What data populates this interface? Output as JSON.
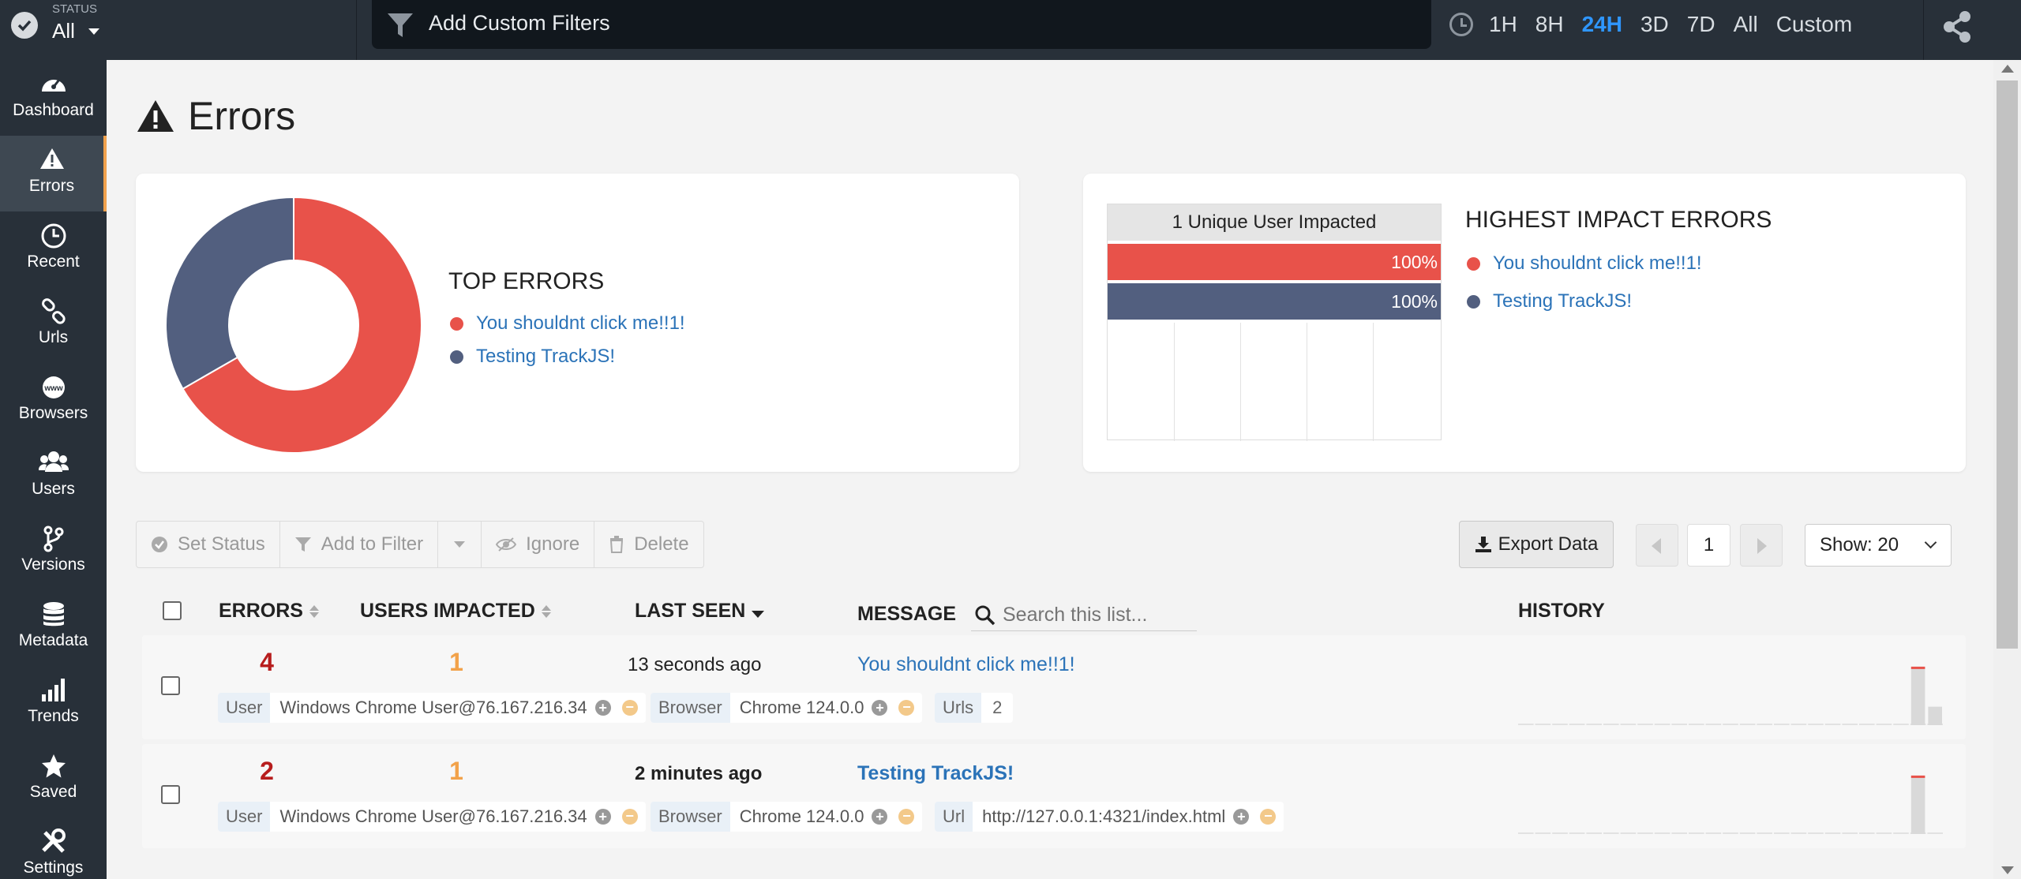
{
  "status": {
    "label": "STATUS",
    "value": "All"
  },
  "filter": {
    "placeholder": "Add Custom Filters"
  },
  "time_ranges": [
    {
      "label": "1H",
      "active": false
    },
    {
      "label": "8H",
      "active": false
    },
    {
      "label": "24H",
      "active": true
    },
    {
      "label": "3D",
      "active": false
    },
    {
      "label": "7D",
      "active": false
    },
    {
      "label": "All",
      "active": false
    },
    {
      "label": "Custom",
      "active": false
    }
  ],
  "sidebar": {
    "items": [
      {
        "label": "Dashboard",
        "icon": "dashboard-icon"
      },
      {
        "label": "Errors",
        "icon": "warning-icon",
        "active": true
      },
      {
        "label": "Recent",
        "icon": "clock-icon"
      },
      {
        "label": "Urls",
        "icon": "link-icon"
      },
      {
        "label": "Browsers",
        "icon": "globe-icon"
      },
      {
        "label": "Users",
        "icon": "users-icon"
      },
      {
        "label": "Versions",
        "icon": "branch-icon"
      },
      {
        "label": "Metadata",
        "icon": "database-icon"
      },
      {
        "label": "Trends",
        "icon": "bars-icon"
      },
      {
        "label": "Saved",
        "icon": "star-icon"
      },
      {
        "label": "Settings",
        "icon": "tools-icon"
      }
    ]
  },
  "page": {
    "title": "Errors"
  },
  "top_errors": {
    "heading": "TOP ERRORS",
    "items": [
      {
        "label": "You shouldnt click me!!1!",
        "color": "#e8524a",
        "share": 0.667
      },
      {
        "label": "Testing TrackJS!",
        "color": "#525f7f",
        "share": 0.333
      }
    ]
  },
  "impact": {
    "chart_header": "1 Unique User Impacted",
    "heading": "HIGHEST IMPACT ERRORS",
    "bars": [
      {
        "value": "100%",
        "fraction": 1.0,
        "color": "#e8524a"
      },
      {
        "value": "100%",
        "fraction": 1.0,
        "color": "#525f7f"
      }
    ],
    "legend": [
      {
        "label": "You shouldnt click me!!1!",
        "color": "#e8524a"
      },
      {
        "label": "Testing TrackJS!",
        "color": "#525f7f"
      }
    ]
  },
  "toolbar": {
    "set_status": "Set Status",
    "add_to_filter": "Add to Filter",
    "ignore": "Ignore",
    "delete": "Delete",
    "export": "Export Data",
    "page": "1",
    "show": "Show: 20"
  },
  "table": {
    "headers": {
      "errors": "ERRORS",
      "users": "USERS IMPACTED",
      "last_seen": "LAST SEEN",
      "message": "MESSAGE",
      "history": "HISTORY"
    },
    "search_placeholder": "Search this list...",
    "rows": [
      {
        "errors": "4",
        "users": "1",
        "last_seen": "13 seconds ago",
        "message": "You shouldnt click me!!1!",
        "user_key": "User",
        "user_val": "Windows Chrome User@76.167.216.34",
        "browser_key": "Browser",
        "browser_val": "Chrome 124.0.0",
        "third_key": "Urls",
        "third_val": "2",
        "history": [
          0,
          0,
          0,
          0,
          0,
          0,
          0,
          0,
          0,
          0,
          0,
          0,
          0,
          0,
          0,
          0,
          0,
          0,
          0,
          0,
          0,
          0,
          0,
          0.95,
          0.3
        ]
      },
      {
        "errors": "2",
        "users": "1",
        "last_seen": "2 minutes ago",
        "message": "Testing TrackJS!",
        "user_key": "User",
        "user_val": "Windows Chrome User@76.167.216.34",
        "browser_key": "Browser",
        "browser_val": "Chrome 124.0.0",
        "third_key": "Url",
        "third_val": "http://127.0.0.1:4321/index.html",
        "history": [
          0,
          0,
          0,
          0,
          0,
          0,
          0,
          0,
          0,
          0,
          0,
          0,
          0,
          0,
          0,
          0,
          0,
          0,
          0,
          0,
          0,
          0,
          0,
          0.95,
          0
        ]
      }
    ]
  }
}
